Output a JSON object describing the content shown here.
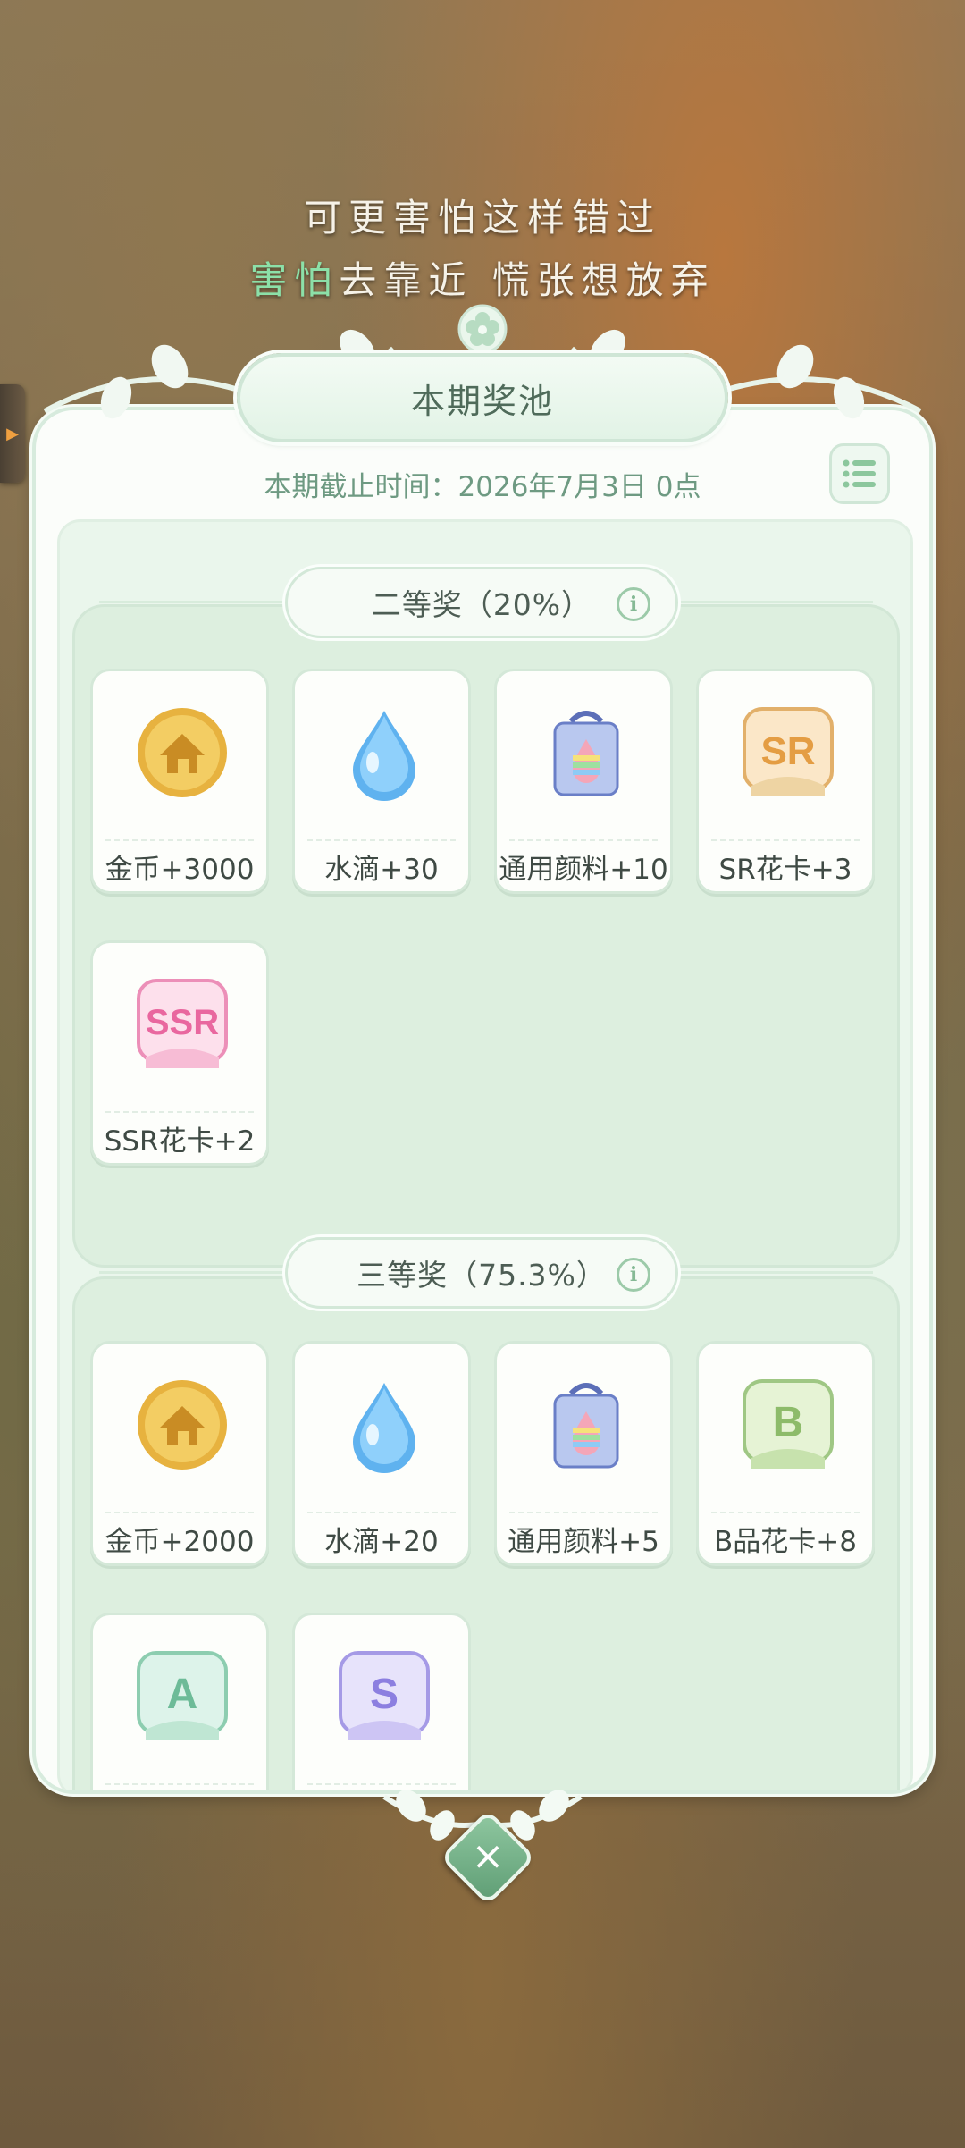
{
  "lyrics": {
    "line1": "可更害怕这样错过",
    "line2_highlight": "害怕",
    "line2_rest": "去靠近 慌张想放弃"
  },
  "panel": {
    "title": "本期奖池",
    "deadline": "本期截止时间：2026年7月3日 0点"
  },
  "tiers": [
    {
      "label": "二等奖（20%）",
      "items": [
        {
          "label": "金币+3000",
          "icon": "gold-coin-icon"
        },
        {
          "label": "水滴+30",
          "icon": "water-drop-icon"
        },
        {
          "label": "通用颜料+10",
          "icon": "paint-bucket-icon"
        },
        {
          "label": "SR花卡+3",
          "icon": "sr-flower-card-icon"
        },
        {
          "label": "SSR花卡+2",
          "icon": "ssr-flower-card-icon"
        }
      ]
    },
    {
      "label": "三等奖（75.3%）",
      "items": [
        {
          "label": "金币+2000",
          "icon": "gold-coin-icon"
        },
        {
          "label": "水滴+20",
          "icon": "water-drop-icon"
        },
        {
          "label": "通用颜料+5",
          "icon": "paint-bucket-icon"
        },
        {
          "label": "B品花卡+8",
          "icon": "b-flower-card-icon"
        },
        {
          "label": "",
          "icon": "a-flower-card-icon"
        },
        {
          "label": "",
          "icon": "s-flower-card-icon"
        }
      ]
    }
  ],
  "card_badges": {
    "sr": "SR",
    "ssr": "SSR",
    "b": "B",
    "a": "A",
    "s": "S"
  },
  "colors": {
    "accent_green": "#6e9a82",
    "lyric_highlight": "#8ce0a8",
    "panel_bg": "#fbfdfa",
    "tier_bg": "#ddefdf"
  }
}
